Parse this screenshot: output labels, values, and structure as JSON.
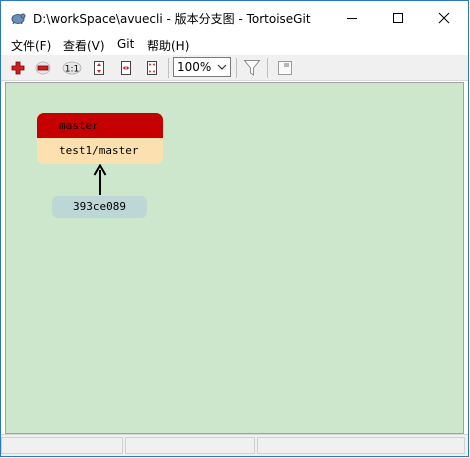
{
  "window": {
    "title": "D:\\workSpace\\avuecli - 版本分支图 - TortoiseGit",
    "icons": {
      "app": "tortoisegit-icon",
      "minimize": "minimize-icon",
      "maximize": "maximize-icon",
      "close": "close-icon"
    }
  },
  "menu": {
    "items": [
      {
        "label": "文件(F)"
      },
      {
        "label": "查看(V)"
      },
      {
        "label": "Git"
      },
      {
        "label": "帮助(H)"
      }
    ]
  },
  "toolbar": {
    "buttons": [
      {
        "icon": "zoom-in-icon"
      },
      {
        "icon": "zoom-out-icon"
      },
      {
        "icon": "actual-size-icon",
        "label": "1:1"
      },
      {
        "icon": "fit-height-icon"
      },
      {
        "icon": "fit-width-icon"
      },
      {
        "icon": "fit-window-icon"
      }
    ],
    "zoom_value": "100%",
    "filter_icon": "filter-icon",
    "overview_icon": "overview-icon"
  },
  "graph": {
    "branch_ref": "master",
    "remote_ref": "test1/master",
    "commit": "393ce089",
    "colors": {
      "background": "#cde7cd",
      "branch_head": "#c60000",
      "remote_ref": "#fde0b0",
      "commit": "#bdd6d6"
    }
  }
}
